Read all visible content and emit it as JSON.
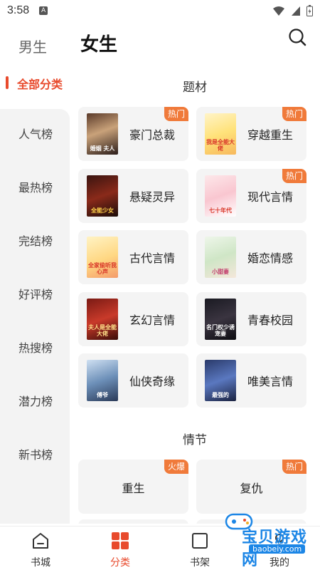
{
  "status_bar": {
    "time": "3:58",
    "app_glyph": "A"
  },
  "header": {
    "tab_male": "男生",
    "tab_female": "女生"
  },
  "sidebar": {
    "active": "全部分类",
    "items": [
      "人气榜",
      "最热榜",
      "完结榜",
      "好评榜",
      "热搜榜",
      "潜力榜",
      "新书榜"
    ]
  },
  "genre_section": {
    "title": "题材",
    "cards": [
      {
        "label": "豪门总裁",
        "badge": "热门",
        "cover_text": "婚姻 夫人"
      },
      {
        "label": "穿越重生",
        "badge": "热门",
        "cover_text": "我是全能大佬"
      },
      {
        "label": "悬疑灵异",
        "badge": "",
        "cover_text": "全能少女"
      },
      {
        "label": "现代言情",
        "badge": "热门",
        "cover_text": "七十年代"
      },
      {
        "label": "古代言情",
        "badge": "",
        "cover_text": "全家偷听我心声"
      },
      {
        "label": "婚恋情感",
        "badge": "",
        "cover_text": "小甜妻"
      },
      {
        "label": "玄幻言情",
        "badge": "",
        "cover_text": "夫人是全能大佬"
      },
      {
        "label": "青春校园",
        "badge": "",
        "cover_text": "名门权少诱宠妻"
      },
      {
        "label": "仙侠奇缘",
        "badge": "",
        "cover_text": "傅爷"
      },
      {
        "label": "唯美言情",
        "badge": "",
        "cover_text": "最强的"
      }
    ]
  },
  "plot_section": {
    "title": "情节",
    "cards": [
      {
        "label": "重生",
        "badge": "火爆"
      },
      {
        "label": "复仇",
        "badge": "热门"
      }
    ]
  },
  "bottom_nav": [
    {
      "label": "书城",
      "icon": "home-icon"
    },
    {
      "label": "分类",
      "icon": "category-icon"
    },
    {
      "label": "书架",
      "icon": "bookshelf-icon"
    },
    {
      "label": "我的",
      "icon": "profile-icon"
    }
  ],
  "watermark": {
    "text": "宝贝游戏网",
    "url": "baobeiy.com"
  },
  "colors": {
    "accent": "#e84a2c",
    "badge": "#f07a3a",
    "card_bg": "#f4f4f4",
    "sidebar_bg": "#f3f3f3"
  }
}
